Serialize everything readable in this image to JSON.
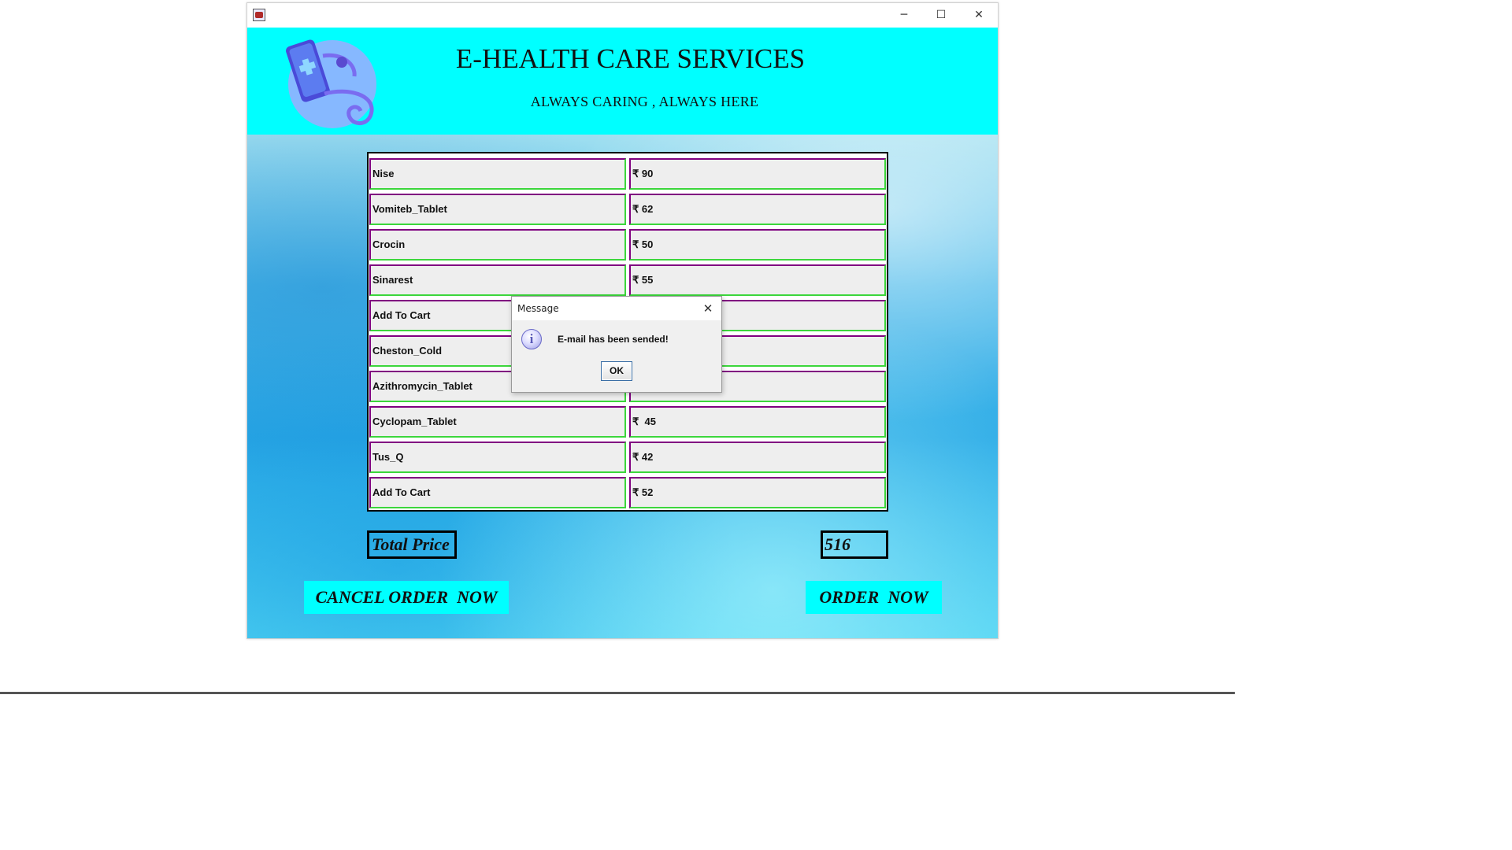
{
  "window": {
    "controls": {
      "minimize": "─",
      "maximize": "☐",
      "close": "✕"
    }
  },
  "header": {
    "title": "E-HEALTH CARE SERVICES",
    "subtitle": "ALWAYS CARING , ALWAYS HERE",
    "logo": "stethoscope-phone-logo"
  },
  "medicines": {
    "names": [
      "Nise",
      "Vomiteb_Tablet",
      "Crocin",
      "Sinarest",
      "Add To Cart",
      "Cheston_Cold",
      "Azithromycin_Tablet",
      "Cyclopam_Tablet",
      "Tus_Q",
      "Add To Cart"
    ],
    "prices": [
      "₹ 90",
      "₹ 62",
      "₹ 50",
      "₹ 55",
      "",
      "",
      "",
      "₹  45",
      "₹ 42",
      "₹ 52"
    ]
  },
  "total": {
    "label": "Total Price",
    "value": "516"
  },
  "buttons": {
    "cancel": "CANCEL ORDER  NOW",
    "order": "ORDER  NOW"
  },
  "dialog": {
    "title": "Message",
    "close": "✕",
    "message": "E-mail has been sended!",
    "ok": "OK",
    "icon": "info-icon",
    "icon_glyph": "i"
  },
  "colors": {
    "header": "#00ffff",
    "button": "#00ffff",
    "cell_border_top_left": "#800080",
    "cell_border_bottom_right": "#3cd63c"
  }
}
